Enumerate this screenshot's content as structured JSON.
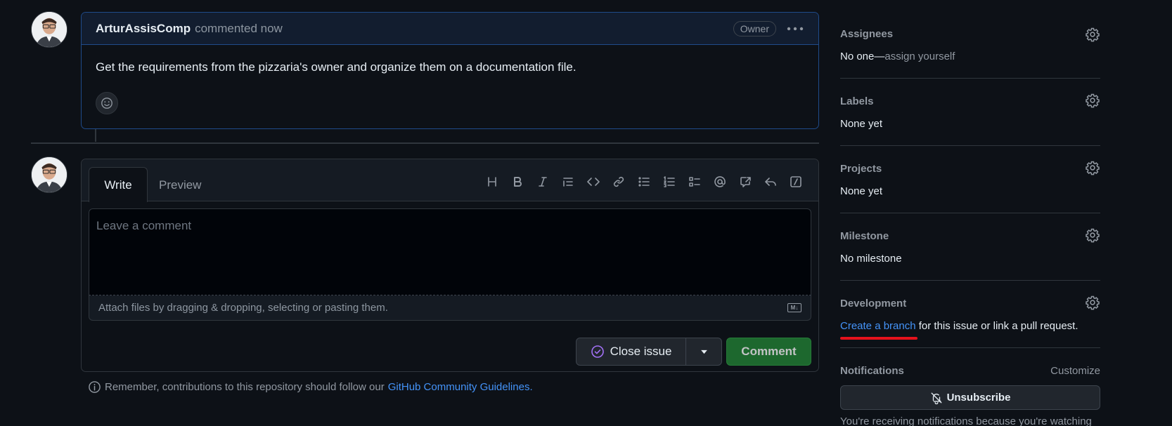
{
  "comment": {
    "author": "ArturAssisComp",
    "meta": "commented now",
    "badge": "Owner",
    "body": "Get the requirements from the pizzaria's owner and organize them on a documentation file."
  },
  "editor": {
    "tab_write": "Write",
    "tab_preview": "Preview",
    "placeholder": "Leave a comment",
    "attach_text": "Attach files by dragging & dropping, selecting or pasting them.",
    "markdown_icon_label": "M↓"
  },
  "actions": {
    "close_issue": "Close issue",
    "comment": "Comment"
  },
  "guideline": {
    "text": "Remember, contributions to this repository should follow our",
    "link": "GitHub Community Guidelines."
  },
  "sidebar": {
    "assignees": {
      "title": "Assignees",
      "value": "No one—",
      "action": "assign yourself"
    },
    "labels": {
      "title": "Labels",
      "value": "None yet"
    },
    "projects": {
      "title": "Projects",
      "value": "None yet"
    },
    "milestone": {
      "title": "Milestone",
      "value": "No milestone"
    },
    "development": {
      "title": "Development",
      "link": "Create a branch",
      "rest": " for this issue or link a pull request."
    },
    "notifications": {
      "title": "Notifications",
      "customize": "Customize",
      "unsubscribe": "Unsubscribe",
      "info": "You're receiving notifications because you're watching"
    }
  },
  "colors": {
    "background": "#0d1117",
    "accent_link": "#4493f8",
    "comment_green": "#238636",
    "annotation_red": "#e5121c",
    "close_purple": "#a371f7"
  }
}
